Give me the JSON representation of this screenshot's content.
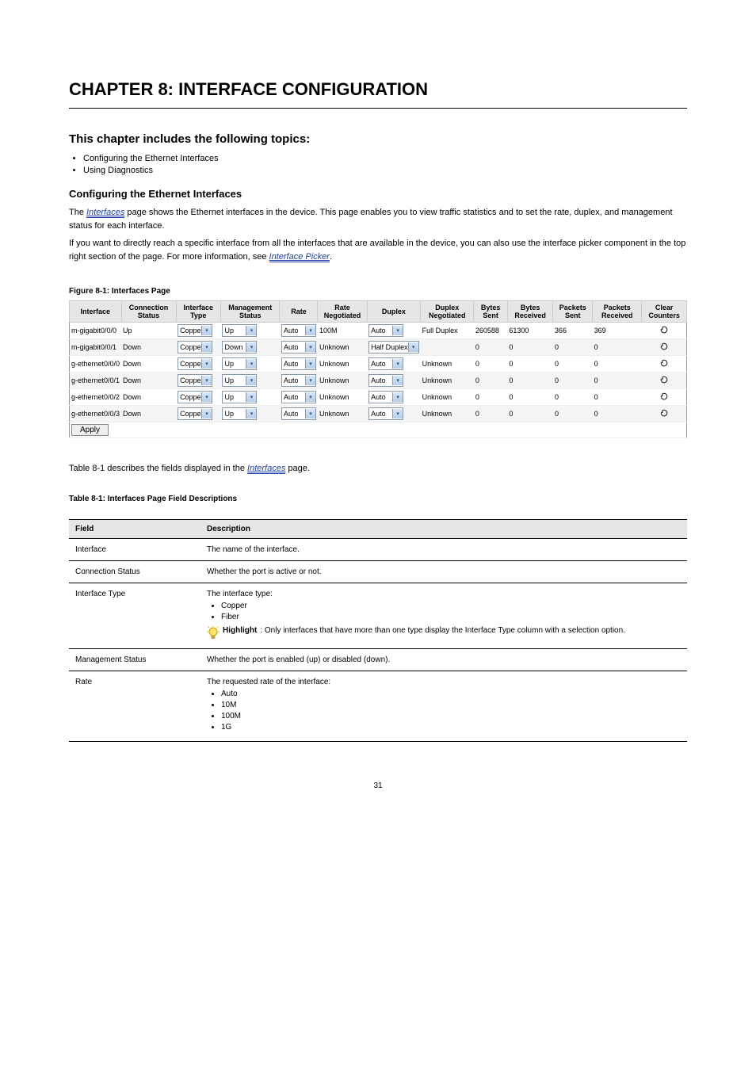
{
  "chapter": {
    "title": "CHAPTER 8: INTERFACE CONFIGURATION"
  },
  "intro": {
    "h2": "This chapter includes the following topics:",
    "items": [
      "Configuring the Ethernet Interfaces",
      "Using Diagnostics"
    ]
  },
  "section": {
    "title": "Configuring the Ethernet Interfaces",
    "p1_prefix": "The ",
    "p1_link": "Interfaces",
    "p1_suffix": " page shows the Ethernet interfaces in the device. This page enables you to view traffic statistics and to set the rate, duplex, and management status for each interface.",
    "p2_prefix": "If you want to directly reach a specific interface from all the interfaces that are available in the device, you can also use the interface picker component in the top right section of the page. For more information, see ",
    "p2_link": "Interface Picker",
    "p2_suffix": "."
  },
  "fig": {
    "caption": "Figure 8-1: Interfaces Page"
  },
  "iftable": {
    "headers": [
      "Interface",
      "Connection Status",
      "Interface Type",
      "Management Status",
      "Rate",
      "Rate Negotiated",
      "Duplex",
      "Duplex Negotiated",
      "Bytes Sent",
      "Bytes Received",
      "Packets Sent",
      "Packets Received",
      "Clear Counters"
    ],
    "mgmt_options": [
      "Up",
      "Down"
    ],
    "rate_options": [
      "Auto"
    ],
    "duplex_options": [
      "Auto",
      "Half Duplex"
    ],
    "rows": [
      {
        "iface": "m-gigabit0/0/0",
        "conn": "Up",
        "type": "Coppe",
        "mgmt": "Up",
        "rate": "Auto",
        "rateneg": "100M",
        "duplex": "Auto",
        "duplexneg": "Full Duplex",
        "bs": "260588",
        "br": "61300",
        "ps": "366",
        "pr": "369",
        "alt": false
      },
      {
        "iface": "m-gigabit0/0/1",
        "conn": "Down",
        "type": "Coppe",
        "mgmt": "Down",
        "rate": "Auto",
        "rateneg": "Unknown",
        "duplex": "Half Duplex",
        "duplexneg": "",
        "bs": "0",
        "br": "0",
        "ps": "0",
        "pr": "0",
        "alt": true
      },
      {
        "iface": "g-ethernet0/0/0",
        "conn": "Down",
        "type": "Coppe",
        "mgmt": "Up",
        "rate": "Auto",
        "rateneg": "Unknown",
        "duplex": "Auto",
        "duplexneg": "Unknown",
        "bs": "0",
        "br": "0",
        "ps": "0",
        "pr": "0",
        "alt": false
      },
      {
        "iface": "g-ethernet0/0/1",
        "conn": "Down",
        "type": "Coppe",
        "mgmt": "Up",
        "rate": "Auto",
        "rateneg": "Unknown",
        "duplex": "Auto",
        "duplexneg": "Unknown",
        "bs": "0",
        "br": "0",
        "ps": "0",
        "pr": "0",
        "alt": true
      },
      {
        "iface": "g-ethernet0/0/2",
        "conn": "Down",
        "type": "Coppe",
        "mgmt": "Up",
        "rate": "Auto",
        "rateneg": "Unknown",
        "duplex": "Auto",
        "duplexneg": "Unknown",
        "bs": "0",
        "br": "0",
        "ps": "0",
        "pr": "0",
        "alt": false
      },
      {
        "iface": "g-ethernet0/0/3",
        "conn": "Down",
        "type": "Coppe",
        "mgmt": "Up",
        "rate": "Auto",
        "rateneg": "Unknown",
        "duplex": "Auto",
        "duplexneg": "Unknown",
        "bs": "0",
        "br": "0",
        "ps": "0",
        "pr": "0",
        "alt": true
      }
    ],
    "apply": "Apply"
  },
  "table_caption_prefix": "Table 8-1 describes the fields displayed in the ",
  "table_caption_link": "Interfaces",
  "table_caption_suffix": " page.",
  "desc": {
    "caption": "Table 8-1: Interfaces Page Field Descriptions",
    "h_field": "Field",
    "h_desc": "Description",
    "rows": [
      {
        "field": "Interface",
        "desc": "The name of the interface."
      },
      {
        "field": "Connection Status",
        "desc": "Whether the port is active or not."
      },
      {
        "field": "Interface Type",
        "desc_intro": "The interface type:",
        "bullets": [
          "Copper",
          "Fiber"
        ],
        "highlight_label": "Highlight",
        "highlight_text": ": Only interfaces that have more than one type display the Interface Type column with a selection option."
      },
      {
        "field": "Management Status",
        "desc": "Whether the port is enabled (up) or disabled (down)."
      },
      {
        "field": "Rate",
        "desc_intro": "The requested rate of the interface:",
        "bullets": [
          "Auto",
          "10M",
          "100M",
          "1G"
        ]
      }
    ]
  },
  "page_number": "31"
}
